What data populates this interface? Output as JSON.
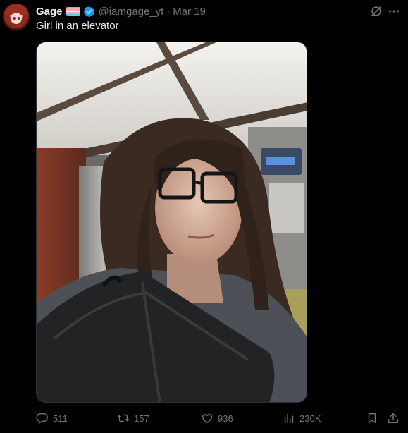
{
  "tweet": {
    "author_name": "Gage",
    "handle": "@iamgage_yt",
    "separator": "·",
    "date": "Mar 19",
    "text": "Girl in an elevator",
    "flag_colors": [
      "#5bcefa",
      "#f5a9b8",
      "#ffffff",
      "#f5a9b8",
      "#5bcefa"
    ],
    "verified_color": "#1d9bf0"
  },
  "icons": {
    "verified": "verified-badge-icon",
    "grok": "grok-icon",
    "more": "more-icon",
    "reply": "reply-icon",
    "retweet": "retweet-icon",
    "like": "heart-icon",
    "views": "views-icon",
    "bookmark": "bookmark-icon",
    "share": "share-icon"
  },
  "metrics": {
    "replies": "511",
    "retweets": "157",
    "likes": "936",
    "views": "230K"
  },
  "colors": {
    "background": "#000000",
    "text_primary": "#e7e9ea",
    "text_secondary": "#71767b"
  }
}
